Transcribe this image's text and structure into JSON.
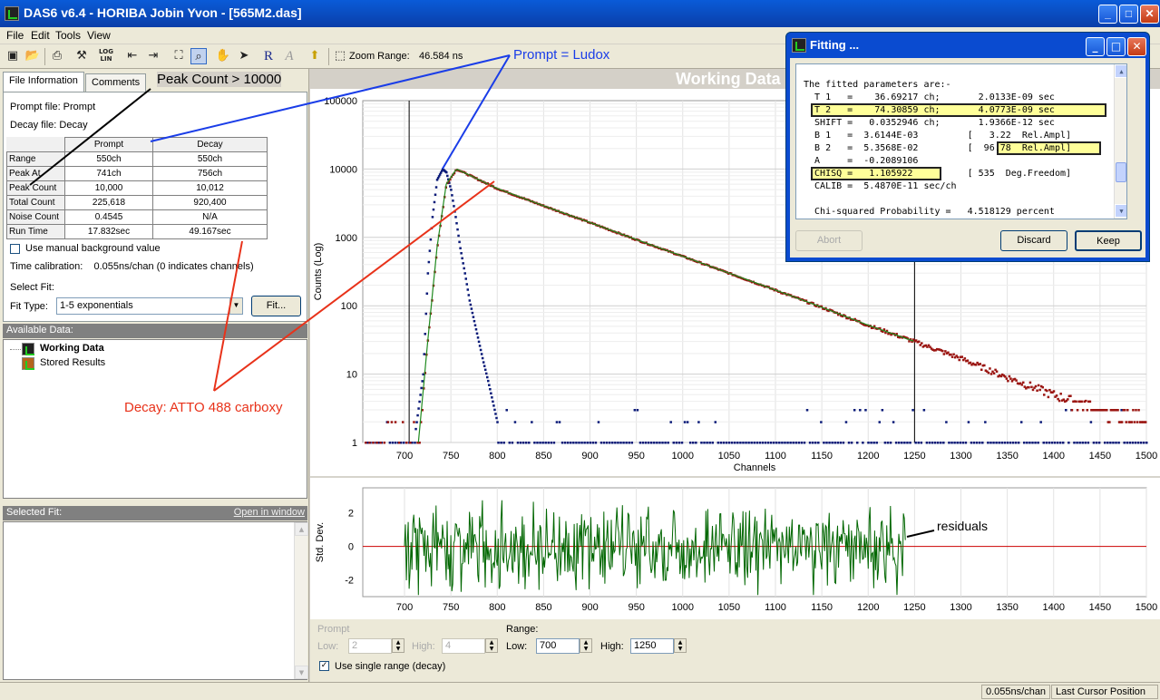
{
  "window": {
    "title": "DAS6 v6.4 - HORIBA Jobin Yvon - [565M2.das]",
    "buttons": [
      "_",
      "□",
      "✕"
    ]
  },
  "menu": [
    "File",
    "Edit",
    "Tools",
    "View"
  ],
  "toolbar": {
    "log_lin_top": "LOG",
    "log_lin_bottom": "LIN",
    "r_label": "R",
    "a_label": "A",
    "zoom_label": "Zoom Range:",
    "zoom_value": "46.584 ns"
  },
  "tabs": [
    "File Information",
    "Comments"
  ],
  "file_info": {
    "prompt_file": "Prompt file: Prompt",
    "decay_file": "Decay file: Decay",
    "columns": [
      "Prompt",
      "Decay"
    ],
    "rows": [
      {
        "label": "Range",
        "prompt": "550ch",
        "decay": "550ch"
      },
      {
        "label": "Peak At",
        "prompt": "741ch",
        "decay": "756ch"
      },
      {
        "label": "Peak Count",
        "prompt": "10,000",
        "decay": "10,012"
      },
      {
        "label": "Total Count",
        "prompt": "225,618",
        "decay": "920,400"
      },
      {
        "label": "Noise Count",
        "prompt": "0.4545",
        "decay": "N/A"
      },
      {
        "label": "Run Time",
        "prompt": "17.832sec",
        "decay": "49.167sec"
      }
    ],
    "manual_bg_label": "Use manual background value",
    "manual_bg_checked": false,
    "time_cal": "Time calibration:    0.055ns/chan (0 indicates channels)",
    "select_fit": "Select Fit:",
    "fit_type_label": "Fit Type:",
    "fit_type_value": "1-5 exponentials",
    "fit_button": "Fit..."
  },
  "available_data": {
    "header": "Available Data:",
    "items": [
      "Working Data",
      "Stored Results"
    ]
  },
  "selected_fit": {
    "header": "Selected Fit:",
    "link": "Open in window"
  },
  "main_title": "Working Data",
  "range_controls": {
    "prompt_label": "Prompt",
    "low_label": "Low:",
    "low_value": "2",
    "high_label": "High:",
    "high_value": "4",
    "range_label": "Range:",
    "range_low_label": "Low:",
    "range_low_value": "700",
    "range_high_label": "High:",
    "range_high_value": "1250",
    "single_range_label": "Use single range (decay)",
    "single_range_checked": true
  },
  "statusbar": {
    "calib": "0.055ns/chan",
    "cursor": "Last Cursor Position"
  },
  "fitting": {
    "title": "Fitting ...",
    "lines": [
      "The fitted parameters are:-",
      "  T 1   =    36.69217 ch;       2.0133E-09 sec",
      "  T 2   =    74.30859 ch;       4.0773E-09 sec",
      "  SHIFT =   0.0352946 ch;       1.9366E-12 sec",
      "  B 1   =  3.6144E-03         [   3.22  Rel.Ampl]",
      "  B 2   =  5.3568E-02         [  96.78  Rel.Ampl]",
      "  A     =  -0.2089106",
      "  CHISQ =   1.105922          [ 535  Deg.Freedom]",
      "  CALIB =  5.4870E-11 sec/ch",
      "",
      "  Chi-squared Probability =   4.518129 percent"
    ],
    "buttons": [
      "Abort",
      "Discard",
      "Keep"
    ]
  },
  "annotations": {
    "peak_count": "Peak Count > 10000",
    "prompt": "Prompt = Ludox",
    "decay": "Decay: ATTO 488 carboxy",
    "residuals": "residuals"
  },
  "colors": {
    "prompt": "#0a1a78",
    "decay": "#9a1410",
    "fit": "#1f8a1f",
    "residual": "#006600",
    "zero_line": "#cc0000",
    "annot_blue": "#1a3de8",
    "annot_red": "#e8321a",
    "title_blue": "#0a4bd0"
  },
  "chart_data": [
    {
      "type": "scatter",
      "title": "Working Data",
      "xlabel": "Channels",
      "ylabel": "Counts (Log)",
      "yscale": "log",
      "xlim": [
        655,
        1500
      ],
      "ylim": [
        1,
        100000
      ],
      "x_ticks": [
        700,
        750,
        800,
        850,
        900,
        950,
        1000,
        1050,
        1100,
        1150,
        1200,
        1250,
        1300,
        1350,
        1400,
        1450,
        1500
      ],
      "y_ticks": [
        "1",
        "10",
        "100",
        "1000",
        "10000",
        "100000"
      ],
      "cursors_x": [
        705,
        1250
      ],
      "grid": true,
      "series": [
        {
          "role": "prompt",
          "x": [
            710,
            720,
            725,
            730,
            735,
            741,
            745,
            750,
            755,
            760,
            765,
            770,
            775,
            780,
            785,
            790,
            795,
            800
          ],
          "y": [
            1,
            10,
            300,
            2000,
            7000,
            10000,
            9000,
            5000,
            2000,
            700,
            300,
            120,
            60,
            30,
            15,
            8,
            4,
            2
          ]
        },
        {
          "role": "decay",
          "x": [
            715,
            725,
            735,
            745,
            756,
            800,
            850,
            900,
            950,
            1000,
            1050,
            1100,
            1150,
            1200,
            1250,
            1300,
            1350,
            1400,
            1450,
            1500
          ],
          "y": [
            1,
            30,
            700,
            6000,
            10012,
            5200,
            2900,
            1650,
            930,
            530,
            300,
            170,
            95,
            52,
            30,
            17,
            9,
            5,
            3,
            2
          ]
        },
        {
          "role": "fit",
          "x": [
            715,
            725,
            735,
            745,
            756,
            800,
            850,
            900,
            950,
            1000,
            1050,
            1100,
            1150,
            1200,
            1250
          ],
          "y": [
            1,
            30,
            700,
            6000,
            10012,
            5200,
            2900,
            1650,
            930,
            530,
            300,
            170,
            95,
            52,
            30
          ]
        }
      ]
    },
    {
      "type": "line",
      "xlabel": "",
      "ylabel": "Std. Dev.",
      "xlim": [
        655,
        1500
      ],
      "ylim": [
        -3,
        3.5
      ],
      "y_ticks": [
        -2,
        0,
        2
      ],
      "x_ticks": [
        700,
        750,
        800,
        850,
        900,
        950,
        1000,
        1050,
        1100,
        1150,
        1200,
        1250,
        1300,
        1350,
        1400,
        1450,
        1500
      ],
      "x_range": [
        700,
        1240
      ],
      "approx_amplitude": 1.5
    }
  ]
}
